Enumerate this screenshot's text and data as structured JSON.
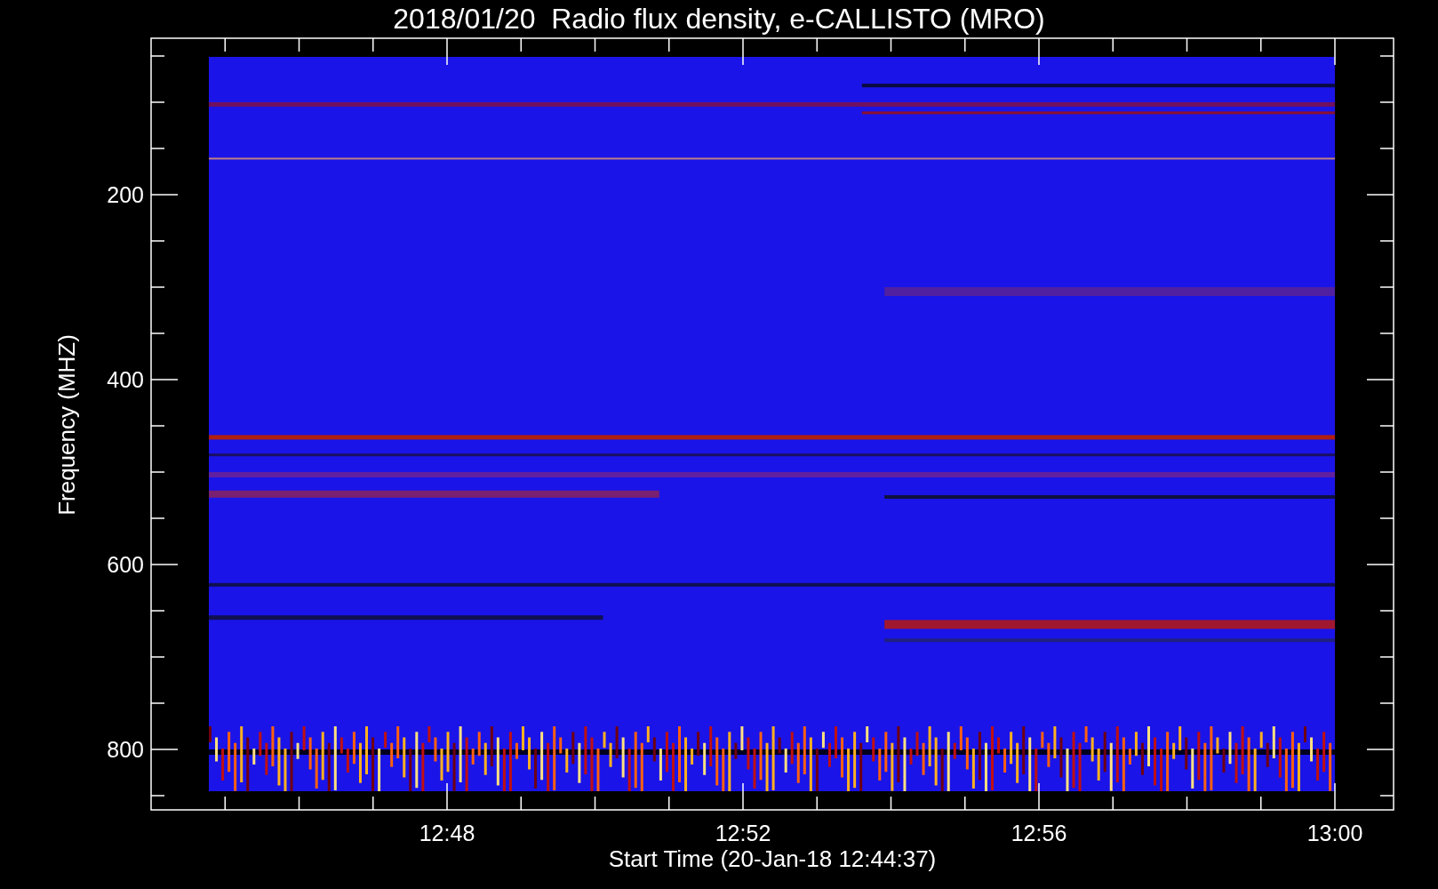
{
  "title": "2018/01/20  Radio flux density, e-CALLISTO (MRO)",
  "plot": {
    "xlabel": "Start Time (20-Jan-18 12:44:37)",
    "ylabel": "Frequency (MHZ)",
    "xticks": [
      "12:48",
      "12:52",
      "12:56",
      "13:00"
    ],
    "yticks": [
      "200",
      "400",
      "600",
      "800"
    ]
  }
}
